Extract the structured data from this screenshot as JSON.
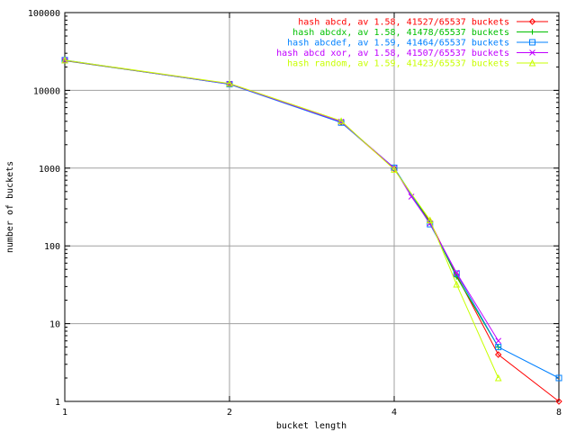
{
  "chart_data": {
    "type": "line",
    "title": "",
    "xlabel": "bucket length",
    "ylabel": "number of buckets",
    "xscale": "log2",
    "yscale": "log10",
    "xlim": [
      1,
      8
    ],
    "ylim": [
      1,
      100000
    ],
    "grid": true,
    "legend_position": "top-right",
    "x_ticks": [
      {
        "value": 1,
        "label": "1"
      },
      {
        "value": 2,
        "label": "2"
      },
      {
        "value": 4,
        "label": "4"
      },
      {
        "value": 8,
        "label": "8"
      }
    ],
    "y_ticks": [
      {
        "value": 1,
        "label": "1"
      },
      {
        "value": 10,
        "label": "10"
      },
      {
        "value": 100,
        "label": "100"
      },
      {
        "value": 1000,
        "label": "1000"
      },
      {
        "value": 10000,
        "label": "10000"
      },
      {
        "value": 100000,
        "label": "100000"
      }
    ],
    "series": [
      {
        "name": "hash abcd, av 1.58, 41527/65537 buckets",
        "color": "#ff0000",
        "marker": "diamond",
        "points": [
          [
            1,
            24300
          ],
          [
            2,
            12100
          ],
          [
            3.2,
            3900
          ],
          [
            4,
            980
          ],
          [
            4.65,
            205
          ],
          [
            5.2,
            42
          ],
          [
            6.2,
            4
          ],
          [
            8,
            1
          ]
        ]
      },
      {
        "name": "hash abcdx, av 1.58, 41478/65537 buckets",
        "color": "#00c000",
        "marker": "plus",
        "points": [
          [
            1,
            24000
          ],
          [
            2,
            12050
          ],
          [
            3.2,
            3920
          ],
          [
            4,
            1000
          ],
          [
            4.65,
            200
          ],
          [
            5.2,
            40
          ],
          [
            6.2,
            5
          ]
        ]
      },
      {
        "name": "hash abcdef, av 1.59, 41464/65537 buckets",
        "color": "#0080ff",
        "marker": "square",
        "points": [
          [
            1,
            24500
          ],
          [
            2,
            12000
          ],
          [
            3.2,
            3850
          ],
          [
            4,
            1010
          ],
          [
            4.65,
            190
          ],
          [
            5.2,
            44
          ],
          [
            6.2,
            5
          ],
          [
            8,
            2
          ]
        ]
      },
      {
        "name": "hash abcd xor, av 1.58, 41507/65537 buckets",
        "color": "#c000ff",
        "marker": "cross",
        "points": [
          [
            1,
            24200
          ],
          [
            2,
            12150
          ],
          [
            3.2,
            3950
          ],
          [
            4,
            1000
          ],
          [
            4.3,
            430
          ],
          [
            4.65,
            195
          ],
          [
            5.2,
            45
          ],
          [
            6.2,
            6
          ]
        ]
      },
      {
        "name": "hash random, av 1.59, 41423/65537 buckets",
        "color": "#c8ff00",
        "marker": "triangle",
        "points": [
          [
            1,
            24400
          ],
          [
            2,
            12250
          ],
          [
            3.2,
            4050
          ],
          [
            4,
            960
          ],
          [
            4.65,
            215
          ],
          [
            5.2,
            32
          ],
          [
            6.2,
            2
          ]
        ]
      }
    ]
  }
}
